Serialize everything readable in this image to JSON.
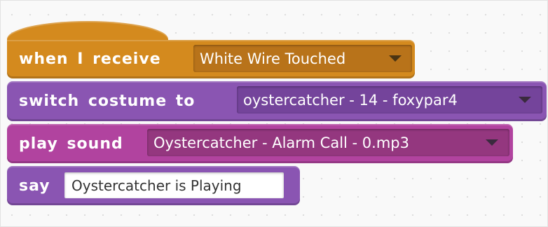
{
  "script": {
    "hat_block": {
      "keyword": "when I receive",
      "message": "White Wire Touched"
    },
    "costume_block": {
      "keyword": "switch costume to",
      "costume": "oystercatcher - 14 - foxypar4"
    },
    "sound_block": {
      "keyword": "play sound",
      "sound": "Oystercatcher - Alarm Call - 0.mp3"
    },
    "say_block": {
      "keyword": "say",
      "text": "Oystercatcher is Playing"
    }
  },
  "colors": {
    "events": "#d48a1e",
    "looks": "#8a55b2",
    "sound": "#b1439f",
    "canvas": "#f9f9f9"
  },
  "icons": [
    "dropdown-arrow-icon"
  ]
}
